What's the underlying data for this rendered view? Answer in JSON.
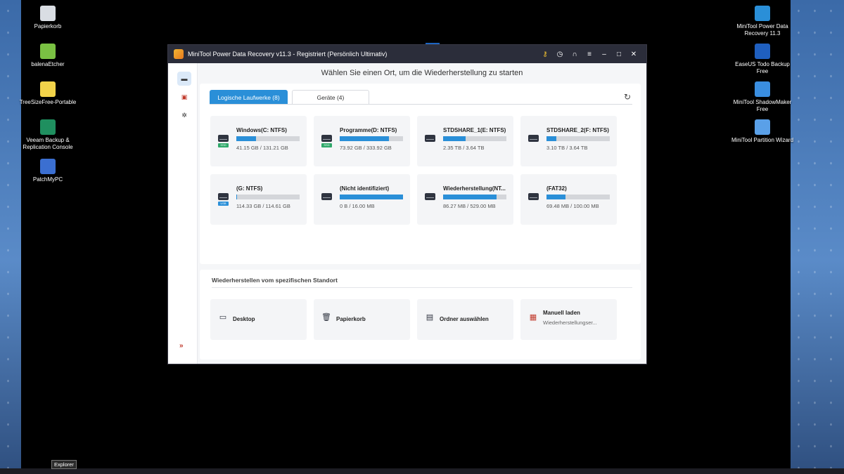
{
  "desktop": {
    "left_icons": [
      {
        "label": "Papierkorb",
        "icon": "recycle-bin-icon",
        "color": "#d9dde3"
      },
      {
        "label": "balenaEtcher",
        "icon": "balena-etcher-icon",
        "color": "#7ac143"
      },
      {
        "label": "TreeSizeFree-Portable",
        "icon": "treesize-icon",
        "color": "#f2d34a"
      },
      {
        "label": "Veeam Backup & Replication Console",
        "icon": "veeam-icon",
        "color": "#1f8f5f"
      },
      {
        "label": "PatchMyPC",
        "icon": "patchmypc-icon",
        "color": "#3b6fd1"
      }
    ],
    "right_icons": [
      {
        "label": "MiniTool Power Data Recovery 11.3",
        "icon": "minitool-pdr-icon",
        "color": "#2a8fd8"
      },
      {
        "label": "EaseUS Todo Backup Free",
        "icon": "easeus-icon",
        "color": "#1f5fbf"
      },
      {
        "label": "MiniTool ShadowMaker Free",
        "icon": "shadowmaker-icon",
        "color": "#3a8ee0"
      },
      {
        "label": "MiniTool Partition Wizard",
        "icon": "partition-wizard-icon",
        "color": "#5aa0e8"
      }
    ]
  },
  "window": {
    "title": "MiniTool Power Data Recovery v11.3 - Registriert (Persönlich Ultimativ)",
    "controls": [
      "key-icon",
      "clock-icon",
      "headset-icon",
      "menu-icon",
      "minimize-icon",
      "maximize-icon",
      "close-icon"
    ],
    "header": "Wählen Sie einen Ort, um die Wiederherstellung zu starten",
    "tabs": [
      {
        "label": "Logische Laufwerke (8)",
        "active": true
      },
      {
        "label": "Geräte (4)",
        "active": false
      }
    ],
    "drives": [
      {
        "name": "Windows(C: NTFS)",
        "size": "41.15 GB / 131.21 GB",
        "fill": 0.31,
        "badge": "SSD",
        "badge_color": "#2fa86a"
      },
      {
        "name": "Programme(D: NTFS)",
        "size": "73.92 GB / 333.92 GB",
        "fill": 0.78,
        "badge": "SSD",
        "badge_color": "#2fa86a"
      },
      {
        "name": "STDSHARE_1(E: NTFS)",
        "size": "2.35 TB / 3.64 TB",
        "fill": 0.35,
        "badge": "",
        "badge_color": ""
      },
      {
        "name": "STDSHARE_2(F: NTFS)",
        "size": "3.10 TB / 3.64 TB",
        "fill": 0.15,
        "badge": "",
        "badge_color": ""
      },
      {
        "name": "(G: NTFS)",
        "size": "114.33 GB / 114.61 GB",
        "fill": 0.01,
        "badge": "USB",
        "badge_color": "#2a8fd8"
      },
      {
        "name": "(Nicht identifiziert)",
        "size": "0 B / 16.00 MB",
        "fill": 1.0,
        "badge": "",
        "badge_color": ""
      },
      {
        "name": "Wiederherstellung(NT...",
        "size": "86.27 MB / 529.00 MB",
        "fill": 0.84,
        "badge": "",
        "badge_color": ""
      },
      {
        "name": "(FAT32)",
        "size": "69.48 MB / 100.00 MB",
        "fill": 0.3,
        "badge": "",
        "badge_color": ""
      }
    ],
    "locations_title": "Wiederherstellen vom spezifischen Standort",
    "locations": [
      {
        "label": "Desktop",
        "sub": "",
        "icon": "desktop-icon",
        "glyph": "▭"
      },
      {
        "label": "Papierkorb",
        "sub": "",
        "icon": "recycle-bin-icon",
        "glyph": "🗑"
      },
      {
        "label": "Ordner auswählen",
        "sub": "",
        "icon": "folder-icon",
        "glyph": "▤"
      },
      {
        "label": "Manuell laden",
        "sub": "Wiederherstellungser...",
        "icon": "load-file-icon",
        "glyph": "▦"
      }
    ]
  },
  "taskbar": {
    "tooltip": "Explorer"
  }
}
